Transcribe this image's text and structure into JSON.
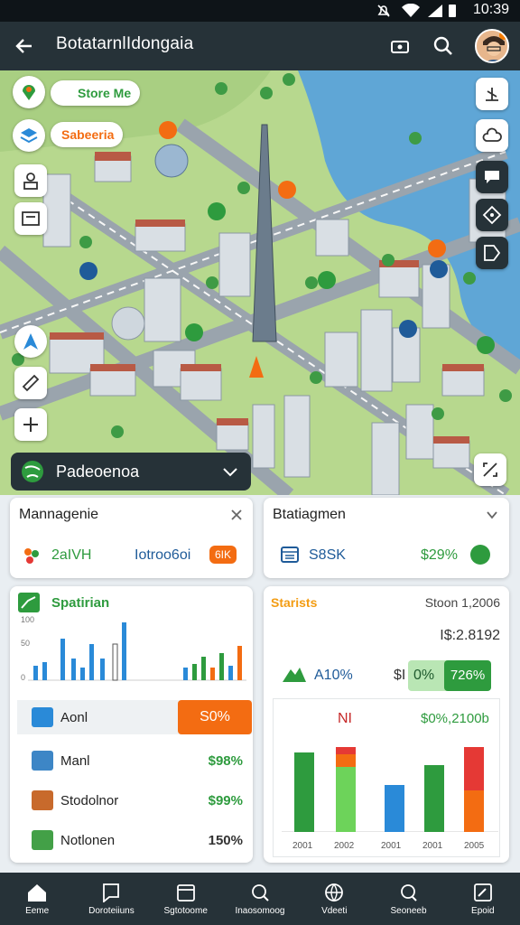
{
  "status_bar": {
    "time": "10:39"
  },
  "app_bar": {
    "title": "BotatarnlΙdongaia"
  },
  "map": {
    "pill_top": "Store Me",
    "pill_second": "Sabeeria"
  },
  "dropdown": {
    "label": "Padeoenoa"
  },
  "card_management": {
    "title": "Mannagenie",
    "left_value": "2aIVH",
    "mid_value": "Iotroo6oi",
    "badge": "6IK"
  },
  "card_statistics_top": {
    "title": "Btatiagmen",
    "value_label": "S8SK",
    "percent": "$29%"
  },
  "card_spatial": {
    "title": "Spatirian",
    "y_ticks": [
      "100",
      "50",
      "0"
    ],
    "rows": [
      {
        "label": "Aonl",
        "value": "S0%"
      },
      {
        "label": "Manl",
        "value": "$98%"
      },
      {
        "label": "Stodolnor",
        "value": "$99%"
      },
      {
        "label": "Notlonen",
        "value": "150%"
      }
    ]
  },
  "card_statistics": {
    "title": "Starists",
    "year_label": "Stoon 1,2006",
    "amount": "I$:2.8192",
    "stat_label": "A10%",
    "prefix": "$I",
    "pct_a": "0%",
    "pct_b": "726%",
    "chart_label": "NI",
    "chart_value": "$0%,2100b",
    "x_labels": [
      "2001",
      "2002",
      "2001",
      "2001",
      "2005"
    ]
  },
  "colors": {
    "bar_dark": "#263238",
    "accent_green": "#2e9b3e",
    "accent_orange": "#f36c12",
    "chart_blue": "#2a8ad8"
  },
  "bottom_nav": [
    {
      "label": "Eeme",
      "icon": "home-icon"
    },
    {
      "label": "Doroteiiuns",
      "icon": "feedback-icon"
    },
    {
      "label": "Sgtotoome",
      "icon": "calendar-icon"
    },
    {
      "label": "Inaosomoog",
      "icon": "search-icon"
    },
    {
      "label": "Vdeeti",
      "icon": "globe-icon"
    },
    {
      "label": "Seoneeb",
      "icon": "chat-search-icon"
    },
    {
      "label": "Epoid",
      "icon": "edit-icon"
    }
  ]
}
